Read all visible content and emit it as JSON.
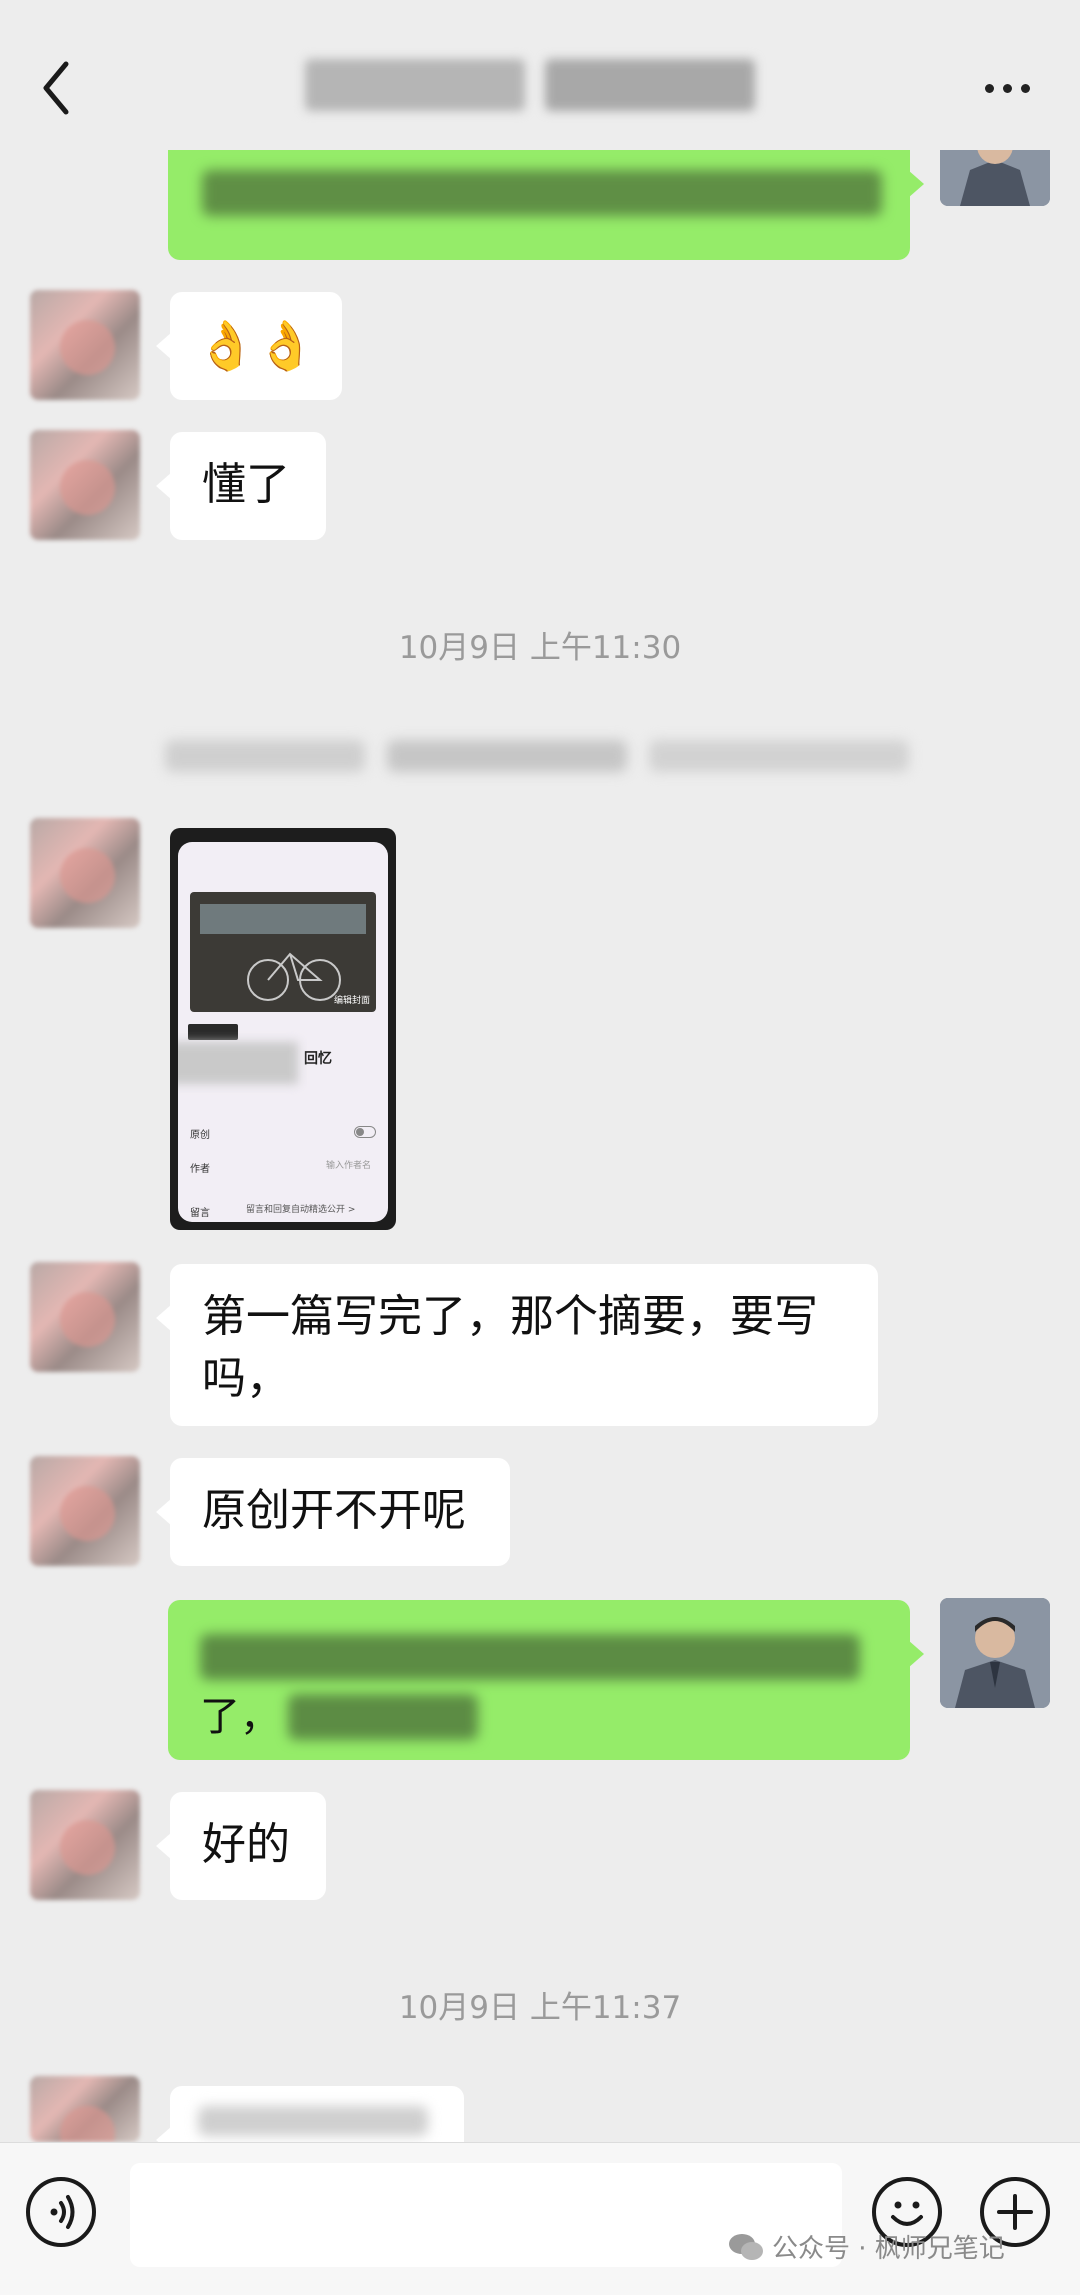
{
  "header": {
    "back_icon": "chevron-left-icon",
    "more_icon": "more-horizontal-icon"
  },
  "messages": {
    "m2": "👌👌",
    "m3": "懂了",
    "m5": "第一篇写完了，那个摘要，要写吗，",
    "m6": "原创开不开呢",
    "m7_fragment": "了，",
    "m8": "好的"
  },
  "timestamps": {
    "t1": "10月9日 上午11:30",
    "t2": "10月9日 上午11:37"
  },
  "photo_screen": {
    "title_suffix": "回忆",
    "row_original": "原创",
    "row_author": "作者",
    "author_placeholder": "输入作者名",
    "row_comment": "留言",
    "comment_value": "留言和回复自动精选公开 >",
    "image_tag": "编辑封面"
  },
  "input_bar": {
    "voice_icon": "voice-icon",
    "emoji_icon": "emoji-icon",
    "plus_icon": "plus-icon"
  },
  "watermark": {
    "text": "公众号 · 枫师兄笔记"
  },
  "colors": {
    "background": "#ededed",
    "self_bubble": "#95ec69",
    "other_bubble": "#ffffff"
  }
}
